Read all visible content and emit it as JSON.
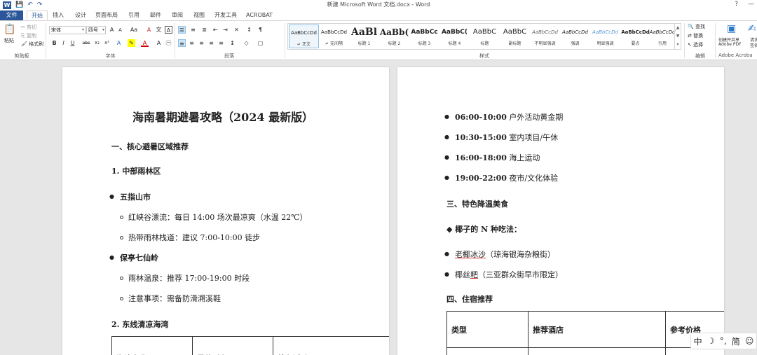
{
  "window": {
    "title": "新建 Microsoft Word 文档.docx - Word",
    "help": "?",
    "minimize": "—",
    "restore": "❐"
  },
  "qat": {
    "logo": "W",
    "save": "💾",
    "undo": "↶",
    "redo": "↷"
  },
  "tabs": [
    "文件",
    "开始",
    "插入",
    "设计",
    "页面布局",
    "引用",
    "邮件",
    "审阅",
    "视图",
    "开发工具",
    "ACROBAT"
  ],
  "ribbon": {
    "clipboard": {
      "label": "剪贴板",
      "paste": "粘贴",
      "cut": "剪切",
      "copy": "复制",
      "format_painter": "格式刷"
    },
    "font": {
      "label": "字体",
      "font_name": "宋体",
      "font_size": "四号",
      "grow": "A",
      "shrink": "A",
      "case": "Aa",
      "bold": "B",
      "italic": "I",
      "underline": "U",
      "strike": "abc",
      "sub": "x₂",
      "sup": "x²"
    },
    "paragraph": {
      "label": "段落"
    },
    "styles": {
      "label": "样式",
      "items": [
        {
          "preview": "AaBbCcDd",
          "name": "↵ 正文"
        },
        {
          "preview": "AaBbCcDd",
          "name": "↵ 无间隔"
        },
        {
          "preview": "AaBl",
          "name": "标题 1"
        },
        {
          "preview": "AaBb(",
          "name": "标题 2"
        },
        {
          "preview": "AaBbCc",
          "name": "标题 3"
        },
        {
          "preview": "AaBbC(",
          "name": "标题 4"
        },
        {
          "preview": "AaBbC",
          "name": "标题"
        },
        {
          "preview": "AaBbC",
          "name": "副标题"
        },
        {
          "preview": "AaBbCcDd",
          "name": "不明显强调"
        },
        {
          "preview": "AaBbCcDd",
          "name": "强调"
        },
        {
          "preview": "AaBbCcDd",
          "name": "明显强调"
        },
        {
          "preview": "AaBbCcDd",
          "name": "要点"
        },
        {
          "preview": "AaBbCcDd",
          "name": "引用"
        }
      ]
    },
    "editing": {
      "label": "编辑",
      "find": "查找",
      "replace": "替换",
      "select": "选择"
    },
    "acrobat": {
      "label": "Adobe Acroba",
      "create_share": "创建并共享",
      "create_share2": "Adobe PDF",
      "request": "请求",
      "request2": "签名"
    }
  },
  "page1": {
    "title": "海南暑期避暑攻略（2024 最新版）",
    "h1": "一、核心避暑区域推荐",
    "h2a": "1.  中部雨林区",
    "b1": "五指山市",
    "b1a": "红峡谷漂流：每日 14:00 场次最凉爽（水温 22℃）",
    "b1b": "热带雨林栈道：建议 7:00-10:00 徒步",
    "b2": "保亭七仙岭",
    "b2a": "雨林温泉：推荐 17:00-19:00 时段",
    "b2b": "注意事项：需备防滑溯溪鞋",
    "h2b": "2.  东线清凉海湾",
    "table_headers": [
      "海湾名称",
      "最佳时段",
      "特色活动"
    ]
  },
  "page2": {
    "s1_time": "06:00-10:00",
    "s1_text": " 户外活动黄金期",
    "s2_time": "10:30-15:00",
    "s2_text": " 室内项目/午休",
    "s3_time": "16:00-18:00",
    "s3_text": " 海上运动",
    "s4_time": "19:00-22:00",
    "s4_text": " 夜市/文化体验",
    "h3": "三、特色降温美食",
    "coconut": "◆  椰子的 N 种吃法：",
    "c1_link": "老椰冰沙",
    "c1_rest": "（琼海银海杂粮街）",
    "c2_a": "椰丝",
    "c2_b": "粑",
    "c2_rest": "（三亚群众街早市限定）",
    "h4": "四、住宿推荐",
    "table_headers": [
      "类型",
      "推荐酒店",
      "参考价格"
    ]
  },
  "ime": {
    "lang": "中",
    "moon": "☽",
    "punct": "°,",
    "simp": "简",
    "emoji": "☺"
  }
}
